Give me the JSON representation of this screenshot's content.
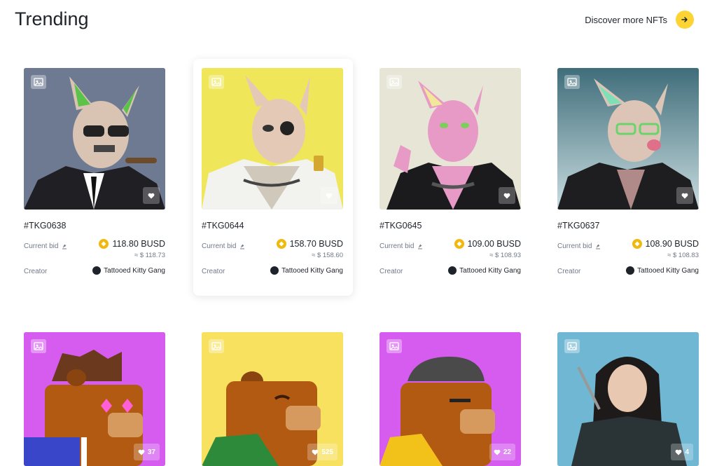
{
  "header": {
    "title": "Trending",
    "discover_label": "Discover more NFTs",
    "discover_icon": "arrow-right-icon"
  },
  "accent_color": "#fcd535",
  "cards_row1": [
    {
      "name": "#TKG0638",
      "bid_label": "Current bid",
      "price": "118.80 BUSD",
      "usd": "≈ $ 118.73",
      "creator_label": "Creator",
      "creator": "Tattooed Kitty Gang",
      "bg": "#6e7a91"
    },
    {
      "name": "#TKG0644",
      "bid_label": "Current bid",
      "price": "158.70 BUSD",
      "usd": "≈ $ 158.60",
      "creator_label": "Creator",
      "creator": "Tattooed Kitty Gang",
      "bg": "#efe65a"
    },
    {
      "name": "#TKG0645",
      "bid_label": "Current bid",
      "price": "109.00 BUSD",
      "usd": "≈ $ 108.93",
      "creator_label": "Creator",
      "creator": "Tattooed Kitty Gang",
      "bg": "#e6e5d6"
    },
    {
      "name": "#TKG0637",
      "bid_label": "Current bid",
      "price": "108.90 BUSD",
      "usd": "≈ $ 108.83",
      "creator_label": "Creator",
      "creator": "Tattooed Kitty Gang",
      "bg": "#4f7f8b"
    }
  ],
  "cards_row2": [
    {
      "likes": "37",
      "bg": "#d65cf0"
    },
    {
      "likes": "525",
      "bg": "#f7e15f"
    },
    {
      "likes": "22",
      "bg": "#d65cf0"
    },
    {
      "likes": "4",
      "bg": "#5fb3d6"
    }
  ]
}
